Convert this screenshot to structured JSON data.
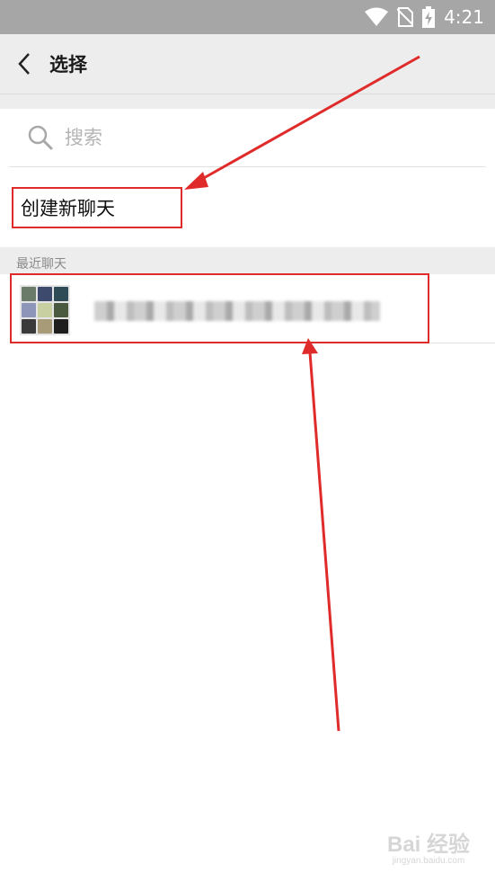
{
  "status_bar": {
    "time": "4:21"
  },
  "header": {
    "title": "选择"
  },
  "search": {
    "placeholder": "搜索"
  },
  "new_chat": {
    "label": "创建新聊天"
  },
  "recent": {
    "section_label": "最近聊天"
  },
  "watermark": {
    "main": "Bai 经验",
    "sub": "jingyan.baidu.com"
  },
  "colors": {
    "highlight": "#e02b2b",
    "appbar": "#ededed",
    "statusbar": "#a6a6a6"
  },
  "icons": [
    "wifi-icon",
    "no-sim-icon",
    "battery-charging-icon",
    "back-arrow-icon",
    "search-icon"
  ]
}
